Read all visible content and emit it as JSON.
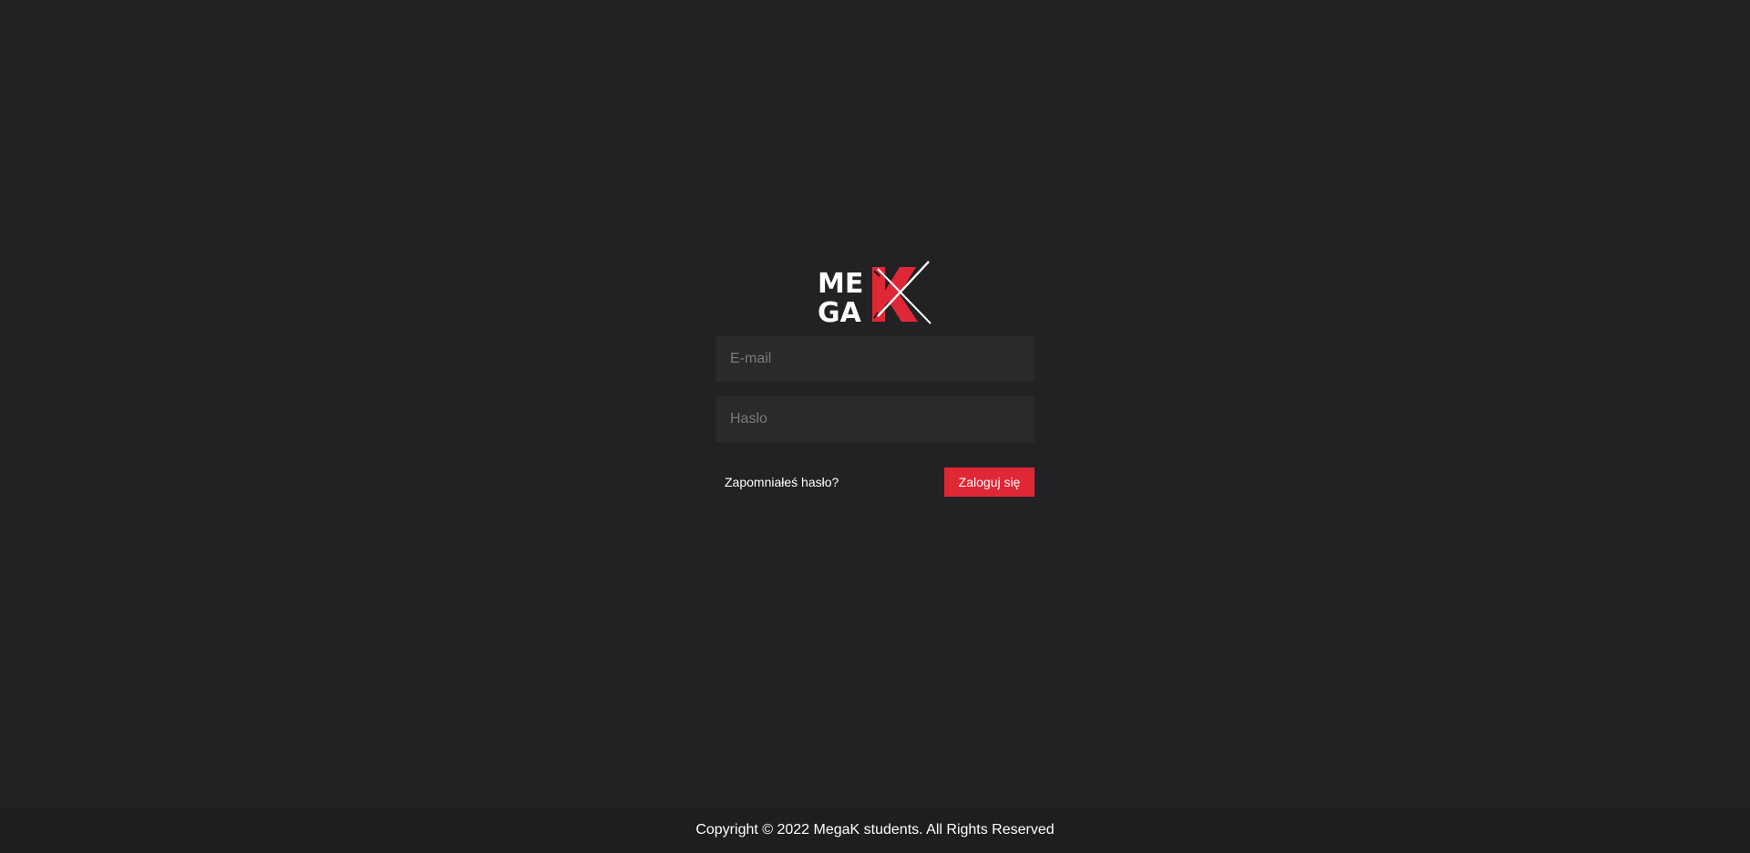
{
  "logo": {
    "alt": "MegaK logo",
    "text_top": "ME",
    "text_bottom": "GA",
    "letter": "K",
    "accent_color": "#e02735"
  },
  "form": {
    "email_placeholder": "E-mail",
    "password_placeholder": "Haslo",
    "forgot_label": "Zapomniałeś hasło?",
    "submit_label": "Zaloguj się"
  },
  "footer": {
    "copyright": "Copyright © 2022 MegaK students. All Rights Reserved"
  }
}
